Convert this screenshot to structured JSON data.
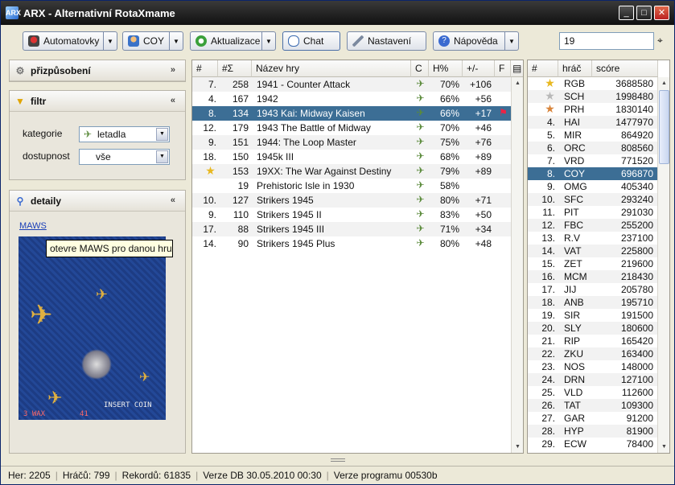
{
  "window": {
    "title": "ARX - Alternativní RotaXmame",
    "app_icon": "ARX"
  },
  "toolbar": {
    "automat_label": "Automatovky",
    "user_label": "COY",
    "update_label": "Aktualizace",
    "chat_label": "Chat",
    "settings_label": "Nastavení",
    "help_label": "Nápověda",
    "search_value": "19"
  },
  "filters": {
    "title": "přizpůsobení",
    "filtr_title": "filtr",
    "category_label": "kategorie",
    "category_value": "letadla",
    "availability_label": "dostupnost",
    "availability_value": "vše"
  },
  "details": {
    "title": "detaily",
    "maws_link": "MAWS",
    "tooltip": "otevre MAWS pro danou hru",
    "screen_text_bottom_left": "3 WAX",
    "screen_text_bottom_mid": "41",
    "screen_text_bottom_right": "INSERT COIN",
    "screen_text_top": "RR"
  },
  "games": {
    "headers": {
      "rank": "#",
      "sum": "#Σ",
      "name": "Název hry",
      "cat": "C",
      "pct": "H%",
      "diff": "+/-",
      "fav": "F"
    },
    "rows": [
      {
        "rank": "7.",
        "sum": "258",
        "name": "1941 - Counter Attack",
        "pct": "70%",
        "diff": "+106",
        "star": false,
        "flag": false
      },
      {
        "rank": "4.",
        "sum": "167",
        "name": "1942",
        "pct": "66%",
        "diff": "+56",
        "star": false,
        "flag": false
      },
      {
        "rank": "8.",
        "sum": "134",
        "name": "1943 Kai: Midway Kaisen",
        "pct": "66%",
        "diff": "+17",
        "star": false,
        "flag": true
      },
      {
        "rank": "12.",
        "sum": "179",
        "name": "1943 The Battle of Midway",
        "pct": "70%",
        "diff": "+46",
        "star": false,
        "flag": false
      },
      {
        "rank": "9.",
        "sum": "151",
        "name": "1944: The Loop Master",
        "pct": "75%",
        "diff": "+76",
        "star": false,
        "flag": false
      },
      {
        "rank": "18.",
        "sum": "150",
        "name": "1945k III",
        "pct": "68%",
        "diff": "+89",
        "star": false,
        "flag": false
      },
      {
        "rank": "",
        "sum": "153",
        "name": "19XX: The War Against Destiny",
        "pct": "79%",
        "diff": "+89",
        "star": true,
        "flag": false
      },
      {
        "rank": "",
        "sum": "19",
        "name": "Prehistoric Isle in 1930",
        "pct": "58%",
        "diff": "",
        "star": false,
        "flag": false
      },
      {
        "rank": "10.",
        "sum": "127",
        "name": "Strikers 1945",
        "pct": "80%",
        "diff": "+71",
        "star": false,
        "flag": false
      },
      {
        "rank": "9.",
        "sum": "110",
        "name": "Strikers 1945 II",
        "pct": "83%",
        "diff": "+50",
        "star": false,
        "flag": false
      },
      {
        "rank": "17.",
        "sum": "88",
        "name": "Strikers 1945 III",
        "pct": "71%",
        "diff": "+34",
        "star": false,
        "flag": false
      },
      {
        "rank": "14.",
        "sum": "90",
        "name": "Strikers 1945 Plus",
        "pct": "80%",
        "diff": "+48",
        "star": false,
        "flag": false
      }
    ],
    "selected_index": 2
  },
  "scores": {
    "headers": {
      "rank": "#",
      "player": "hráč",
      "score": "scóre"
    },
    "rows": [
      {
        "rank": "",
        "medal": "gold",
        "player": "RGB",
        "score": "3688580"
      },
      {
        "rank": "",
        "medal": "silver",
        "player": "SCH",
        "score": "1998480"
      },
      {
        "rank": "",
        "medal": "bronze",
        "player": "PRH",
        "score": "1830140"
      },
      {
        "rank": "4.",
        "player": "HAI",
        "score": "1477970"
      },
      {
        "rank": "5.",
        "player": "MIR",
        "score": "864920"
      },
      {
        "rank": "6.",
        "player": "ORC",
        "score": "808560"
      },
      {
        "rank": "7.",
        "player": "VRD",
        "score": "771520"
      },
      {
        "rank": "8.",
        "player": "COY",
        "score": "696870"
      },
      {
        "rank": "9.",
        "player": "OMG",
        "score": "405340"
      },
      {
        "rank": "10.",
        "player": "SFC",
        "score": "293240"
      },
      {
        "rank": "11.",
        "player": "PIT",
        "score": "291030"
      },
      {
        "rank": "12.",
        "player": "FBC",
        "score": "255200"
      },
      {
        "rank": "13.",
        "player": "R.V",
        "score": "237100"
      },
      {
        "rank": "14.",
        "player": "VAT",
        "score": "225800"
      },
      {
        "rank": "15.",
        "player": "ZET",
        "score": "219600"
      },
      {
        "rank": "16.",
        "player": "MCM",
        "score": "218430"
      },
      {
        "rank": "17.",
        "player": "JIJ",
        "score": "205780"
      },
      {
        "rank": "18.",
        "player": "ANB",
        "score": "195710"
      },
      {
        "rank": "19.",
        "player": "SIR",
        "score": "191500"
      },
      {
        "rank": "20.",
        "player": "SLY",
        "score": "180600"
      },
      {
        "rank": "21.",
        "player": "RIP",
        "score": "165420"
      },
      {
        "rank": "22.",
        "player": "ZKU",
        "score": "163400"
      },
      {
        "rank": "23.",
        "player": "NOS",
        "score": "148000"
      },
      {
        "rank": "24.",
        "player": "DRN",
        "score": "127100"
      },
      {
        "rank": "25.",
        "player": "VLD",
        "score": "112600"
      },
      {
        "rank": "26.",
        "player": "TAT",
        "score": "109300"
      },
      {
        "rank": "27.",
        "player": "GAR",
        "score": "91200"
      },
      {
        "rank": "28.",
        "player": "HYP",
        "score": "81900"
      },
      {
        "rank": "29.",
        "player": "ECW",
        "score": "78400"
      }
    ],
    "selected_index": 7
  },
  "status": {
    "games": "Her: 2205",
    "players": "Hráčů: 799",
    "records": "Rekordů: 61835",
    "db_version": "Verze DB 30.05.2010 00:30",
    "program_version": "Verze programu 00530b"
  },
  "colors": {
    "selection": "#3c6e95",
    "accent": "#1a3fb8"
  },
  "icons": {
    "category": "plane-icon",
    "star": "star-icon",
    "flag": "flag-icon"
  }
}
